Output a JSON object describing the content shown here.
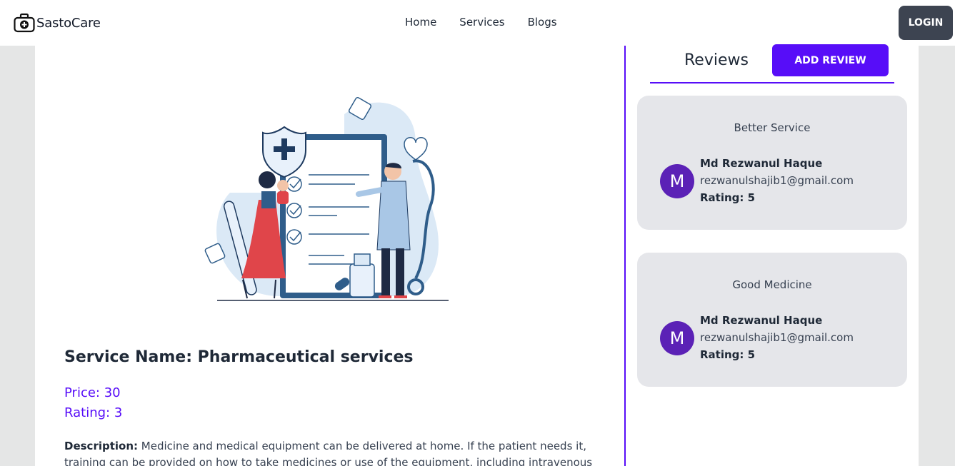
{
  "navbar": {
    "brand": "SastoCare",
    "links": [
      "Home",
      "Services",
      "Blogs"
    ],
    "login_label": "LOGIN"
  },
  "service": {
    "name": "Service Name: Pharmaceutical services",
    "price": "Price: 30",
    "rating": "Rating: 3",
    "description_label": "Description:",
    "description_text": " Medicine and medical equipment can be delivered at home. If the patient needs it, training can be provided on how to take medicines or use of the equipment, including intravenous therapy."
  },
  "reviews": {
    "title": "Reviews",
    "add_label": "ADD REVIEW",
    "items": [
      {
        "title": "Better Service",
        "avatar": "M",
        "name": "Md Rezwanul Haque",
        "email": "rezwanulshajib1@gmail.com",
        "rating": "Rating: 5"
      },
      {
        "title": "Good Medicine",
        "avatar": "M",
        "name": "Md Rezwanul Haque",
        "email": "rezwanulshajib1@gmail.com",
        "rating": "Rating: 5"
      }
    ]
  },
  "colors": {
    "primary": "#570df8",
    "neutral": "#3d4451",
    "avatar": "#5b21b6",
    "card": "#e5e6ea"
  },
  "icons": [
    "medical-bag-icon"
  ]
}
